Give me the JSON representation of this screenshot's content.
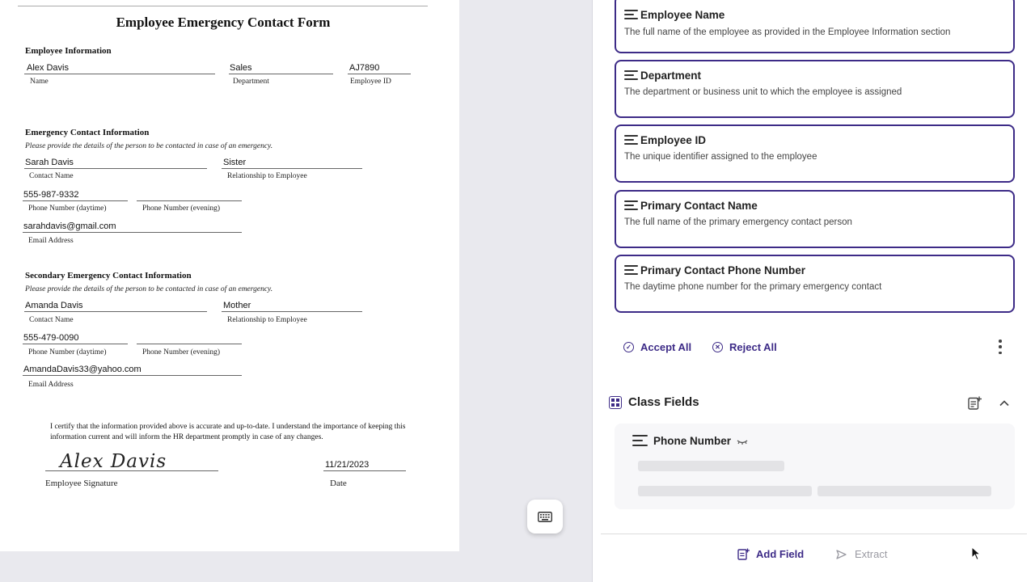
{
  "document": {
    "title": "Employee Emergency Contact Form",
    "employee_info": {
      "heading": "Employee Information",
      "name_value": "Alex Davis",
      "name_label": "Name",
      "department_value": "Sales",
      "department_label": "Department",
      "employee_id_value": "AJ7890",
      "employee_id_label": "Employee ID"
    },
    "emergency_contact": {
      "heading": "Emergency Contact Information",
      "note": "Please provide the details of the person to be contacted in case of an emergency.",
      "contact_name_value": "Sarah Davis",
      "contact_name_label": "Contact Name",
      "relationship_value": "Sister",
      "relationship_label": "Relationship to Employee",
      "phone_day_value": "555-987-9332",
      "phone_day_label": "Phone Number (daytime)",
      "phone_evening_label": "Phone Number (evening)",
      "email_value": "sarahdavis@gmail.com",
      "email_label": "Email Address"
    },
    "secondary_contact": {
      "heading": "Secondary Emergency Contact Information",
      "note": "Please provide the details of the person to be contacted in case of an emergency.",
      "contact_name_value": "Amanda Davis",
      "contact_name_label": "Contact Name",
      "relationship_value": "Mother",
      "relationship_label": "Relationship to Employee",
      "phone_day_value": "555-479-0090",
      "phone_day_label": "Phone Number (daytime)",
      "phone_evening_label": "Phone Number (evening)",
      "email_value": "AmandaDavis33@yahoo.com",
      "email_label": "Email Address"
    },
    "certification": "I certify that the information provided above is accurate and up-to-date. I understand the importance of keeping this information current and will inform the HR department promptly in case of any changes.",
    "signature_text": "Alex Davis",
    "signature_label": "Employee Signature",
    "date_value": "11/21/2023",
    "date_label": "Date"
  },
  "fields": [
    {
      "title": "Employee Name",
      "description": "The full name of the employee as provided in the Employee Information section"
    },
    {
      "title": "Department",
      "description": "The department or business unit to which the employee is assigned"
    },
    {
      "title": "Employee ID",
      "description": "The unique identifier assigned to the employee"
    },
    {
      "title": "Primary Contact Name",
      "description": "The full name of the primary emergency contact person"
    },
    {
      "title": "Primary Contact Phone Number",
      "description": "The daytime phone number for the primary emergency contact"
    }
  ],
  "actions": {
    "accept_all": "Accept All",
    "reject_all": "Reject All"
  },
  "class_fields": {
    "heading": "Class Fields",
    "item_title": "Phone Number"
  },
  "footer": {
    "add_field": "Add Field",
    "extract": "Extract"
  },
  "icons": {
    "keyboard": "keyboard-icon",
    "more": "more-vertical-icon",
    "lines": "text-lines-icon",
    "eye_off": "eye-off-icon"
  },
  "colors": {
    "accent": "#3d2b87",
    "disabled": "#9a9aa2"
  }
}
